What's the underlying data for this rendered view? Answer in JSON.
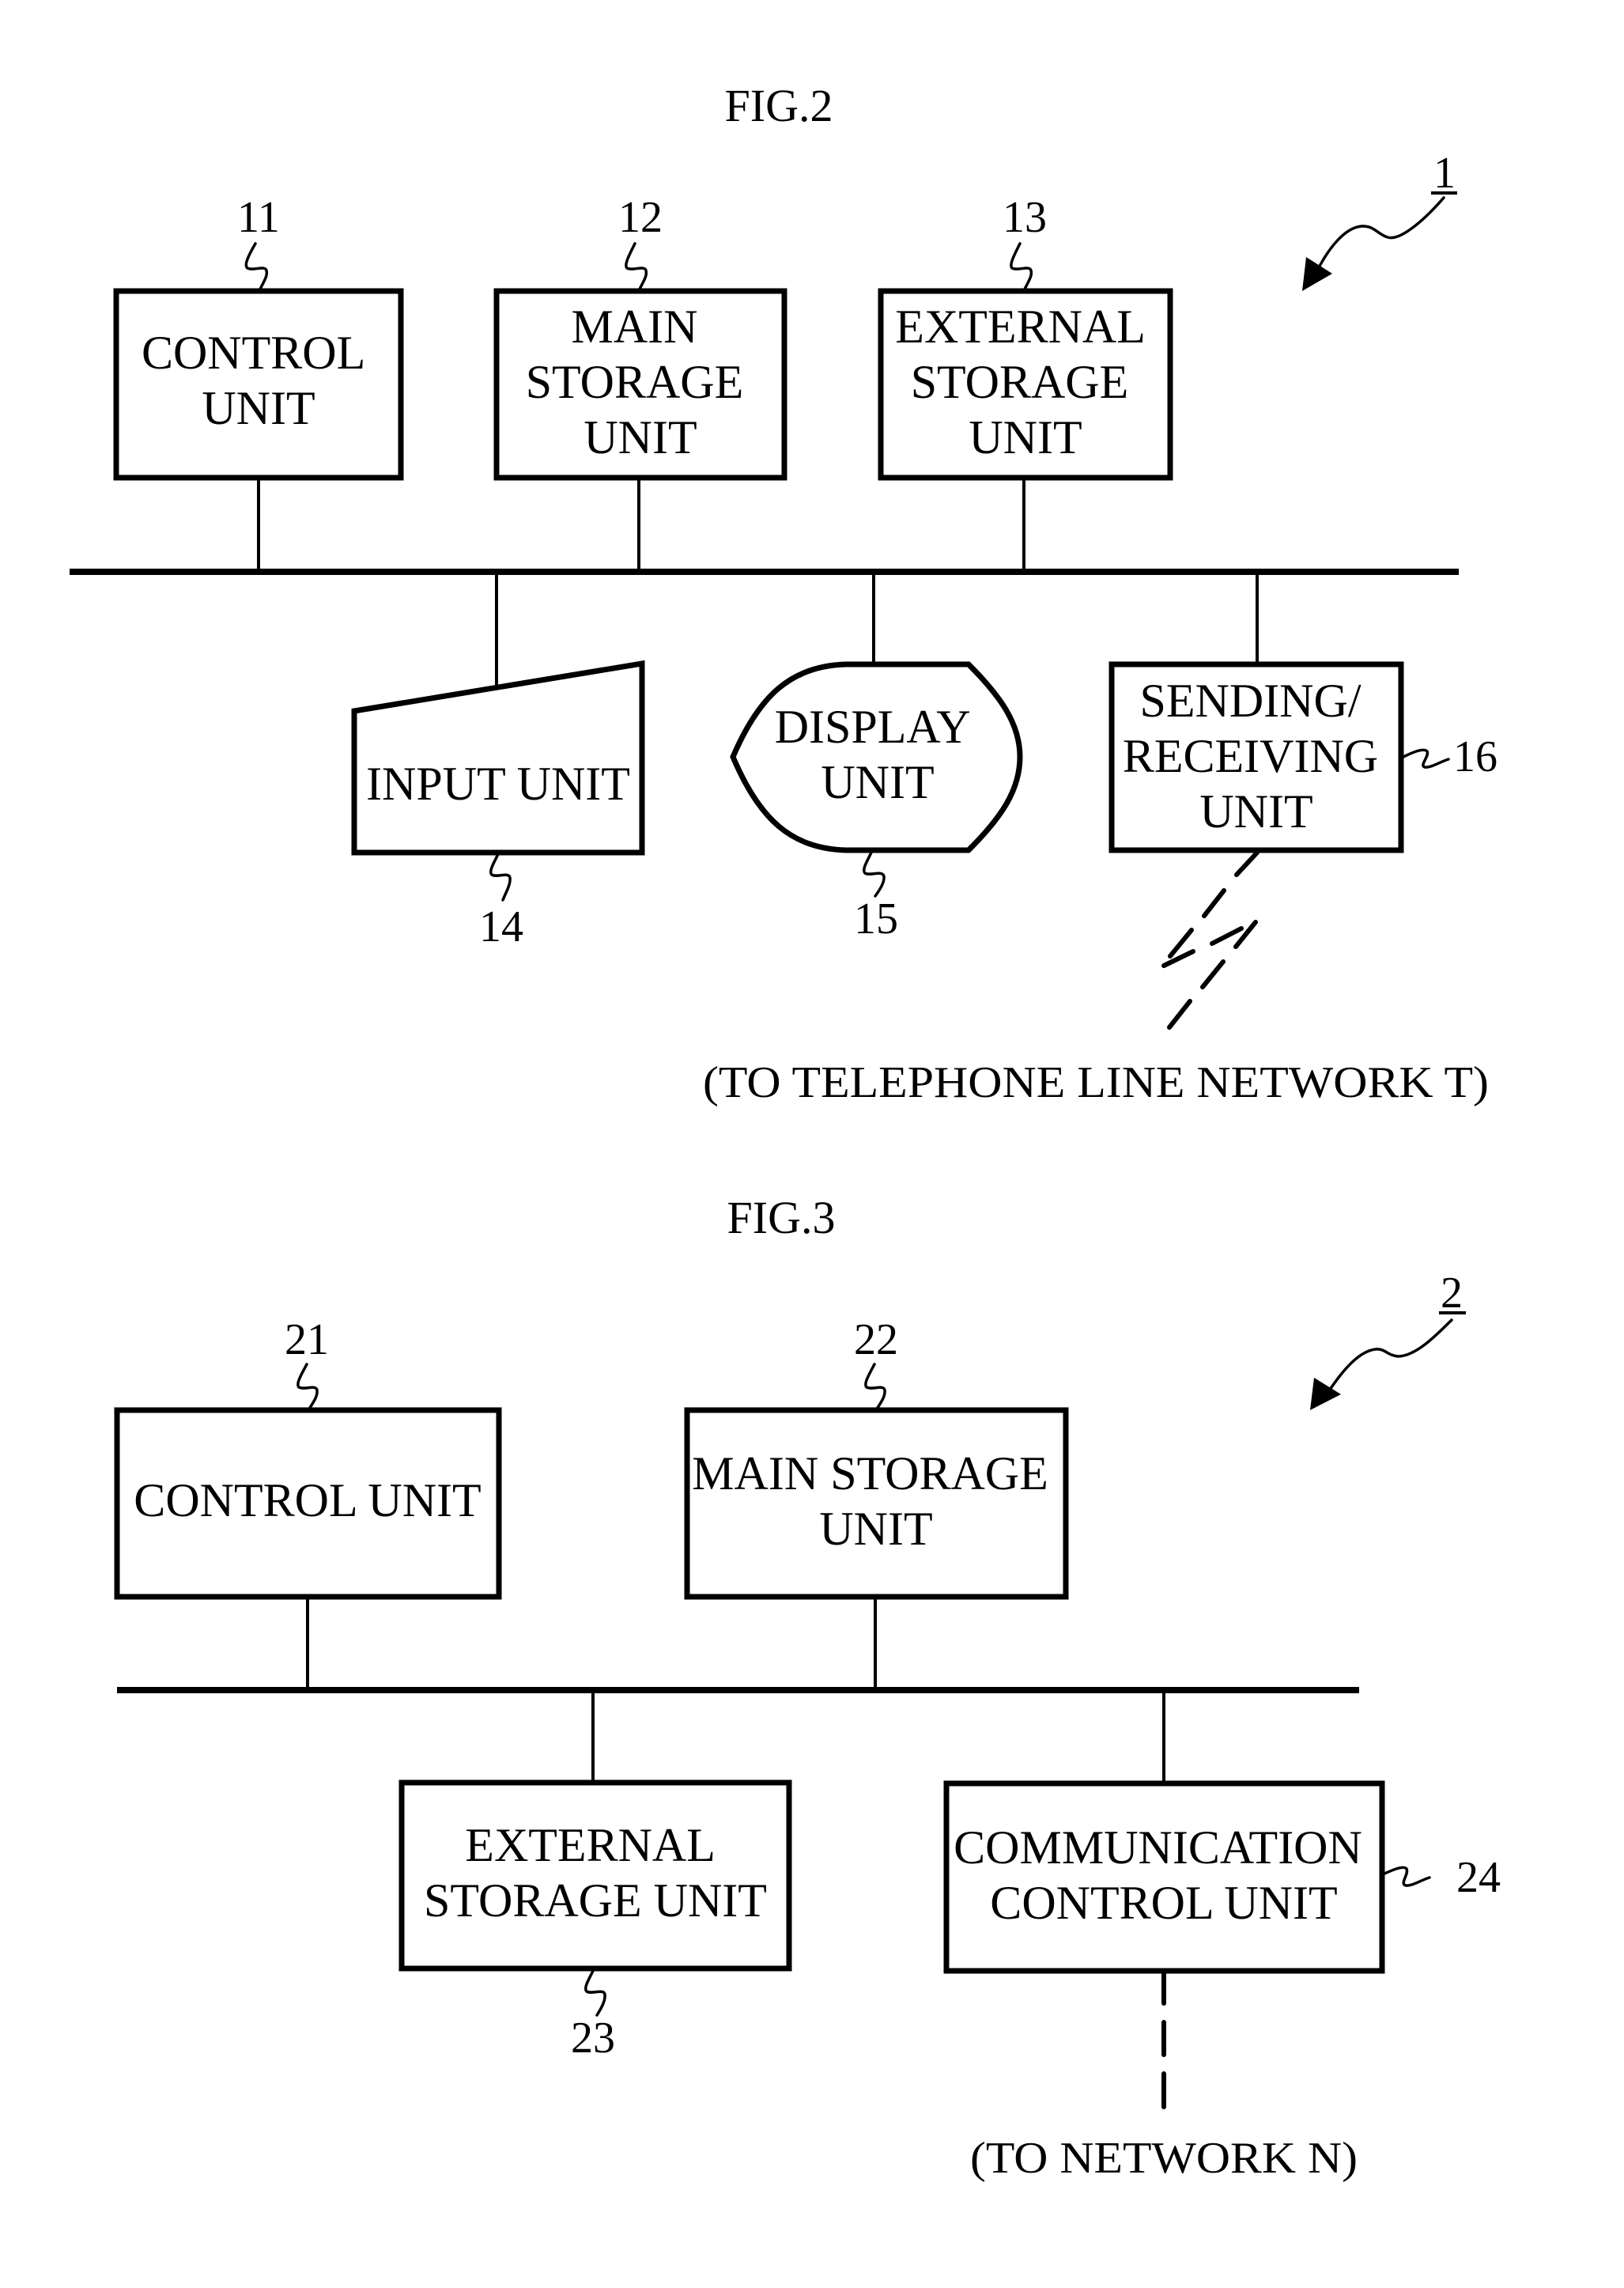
{
  "fig2": {
    "caption": "FIG.2",
    "system_ref": "1",
    "units": {
      "control": {
        "ref": "11",
        "lines": [
          "CONTROL",
          "UNIT"
        ]
      },
      "main_storage": {
        "ref": "12",
        "lines": [
          "MAIN",
          "STORAGE",
          "UNIT"
        ]
      },
      "external_storage": {
        "ref": "13",
        "lines": [
          "EXTERNAL",
          "STORAGE",
          "UNIT"
        ]
      },
      "input": {
        "ref": "14",
        "lines": [
          "INPUT UNIT"
        ]
      },
      "display": {
        "ref": "15",
        "lines": [
          "DISPLAY",
          "UNIT"
        ]
      },
      "sending_receiving": {
        "ref": "16",
        "lines": [
          "SENDING/",
          "RECEIVING",
          "UNIT"
        ]
      }
    },
    "external_link_note": "(TO TELEPHONE LINE NETWORK T)"
  },
  "fig3": {
    "caption": "FIG.3",
    "system_ref": "2",
    "units": {
      "control": {
        "ref": "21",
        "lines": [
          "CONTROL UNIT"
        ]
      },
      "main_storage": {
        "ref": "22",
        "lines": [
          "MAIN STORAGE",
          "UNIT"
        ]
      },
      "external_storage": {
        "ref": "23",
        "lines": [
          "EXTERNAL",
          "STORAGE UNIT"
        ]
      },
      "communication_control": {
        "ref": "24",
        "lines": [
          "COMMUNICATION",
          "CONTROL UNIT"
        ]
      }
    },
    "external_link_note": "(TO NETWORK N)"
  }
}
